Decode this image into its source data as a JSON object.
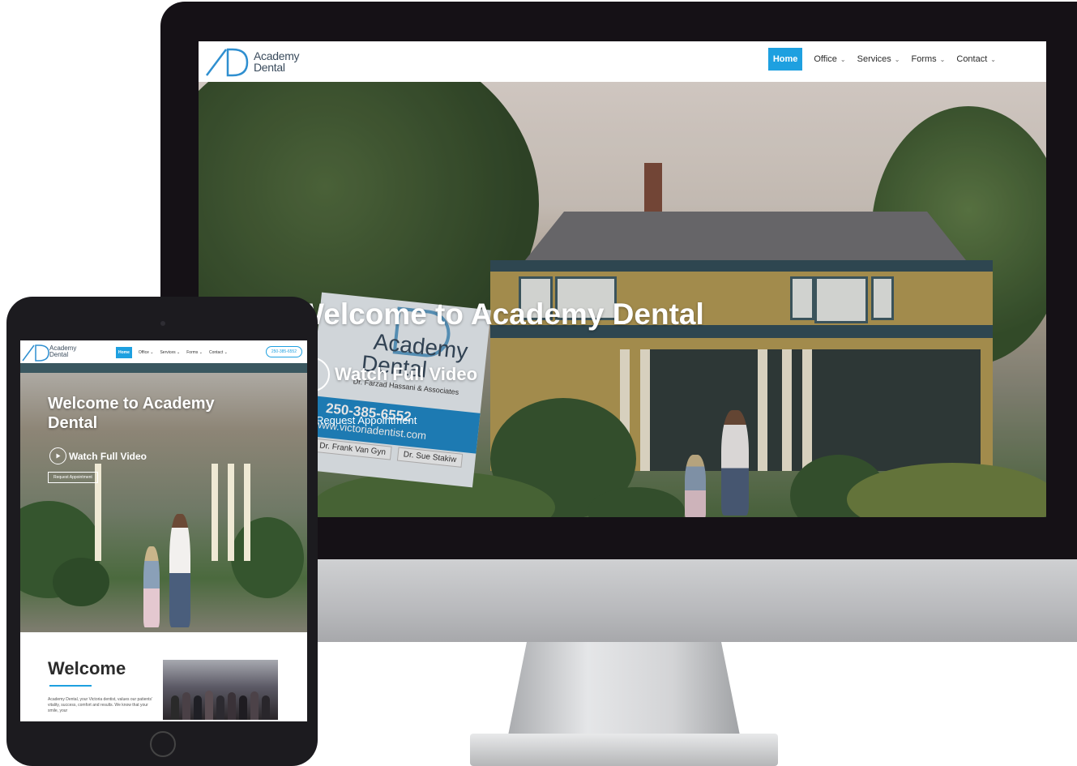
{
  "brand": {
    "name_line1": "Academy",
    "name_line2": "Dental",
    "accent": "#1ea0e0"
  },
  "desktop": {
    "nav": [
      {
        "label": "Home",
        "active": true
      },
      {
        "label": "Office",
        "caret": "⌄"
      },
      {
        "label": "Services",
        "caret": "⌄"
      },
      {
        "label": "Forms",
        "caret": "⌄"
      },
      {
        "label": "Contact",
        "caret": "⌄"
      }
    ],
    "hero": {
      "title": "Welcome to Academy Dental",
      "video_label": "Watch Full Video",
      "request_label": "Request Appointment",
      "sign": {
        "name_top": "Academy",
        "name_bottom": "Dental",
        "associates": "Dr. Farzad Hassani & Associates",
        "phone": "250-385-6552",
        "website": "www.victoriadentist.com",
        "doctor1": "Dr. Frank Van Gyn",
        "doctor2": "Dr. Sue Stakiw"
      }
    }
  },
  "tablet": {
    "nav": [
      {
        "label": "Home",
        "active": true
      },
      {
        "label": "Office ⌄"
      },
      {
        "label": "Services ⌄"
      },
      {
        "label": "Forms ⌄"
      },
      {
        "label": "Contact ⌄"
      }
    ],
    "phone": "250-385-6552",
    "hero": {
      "title": "Welcome to Academy Dental",
      "video_label": "Watch Full Video",
      "request_label": "Request Appointment"
    },
    "welcome": {
      "heading": "Welcome",
      "body": "Academy Dental, your Victoria dentist, values our patients' vitality, success, comfort and results. We know that your smile, your"
    }
  }
}
